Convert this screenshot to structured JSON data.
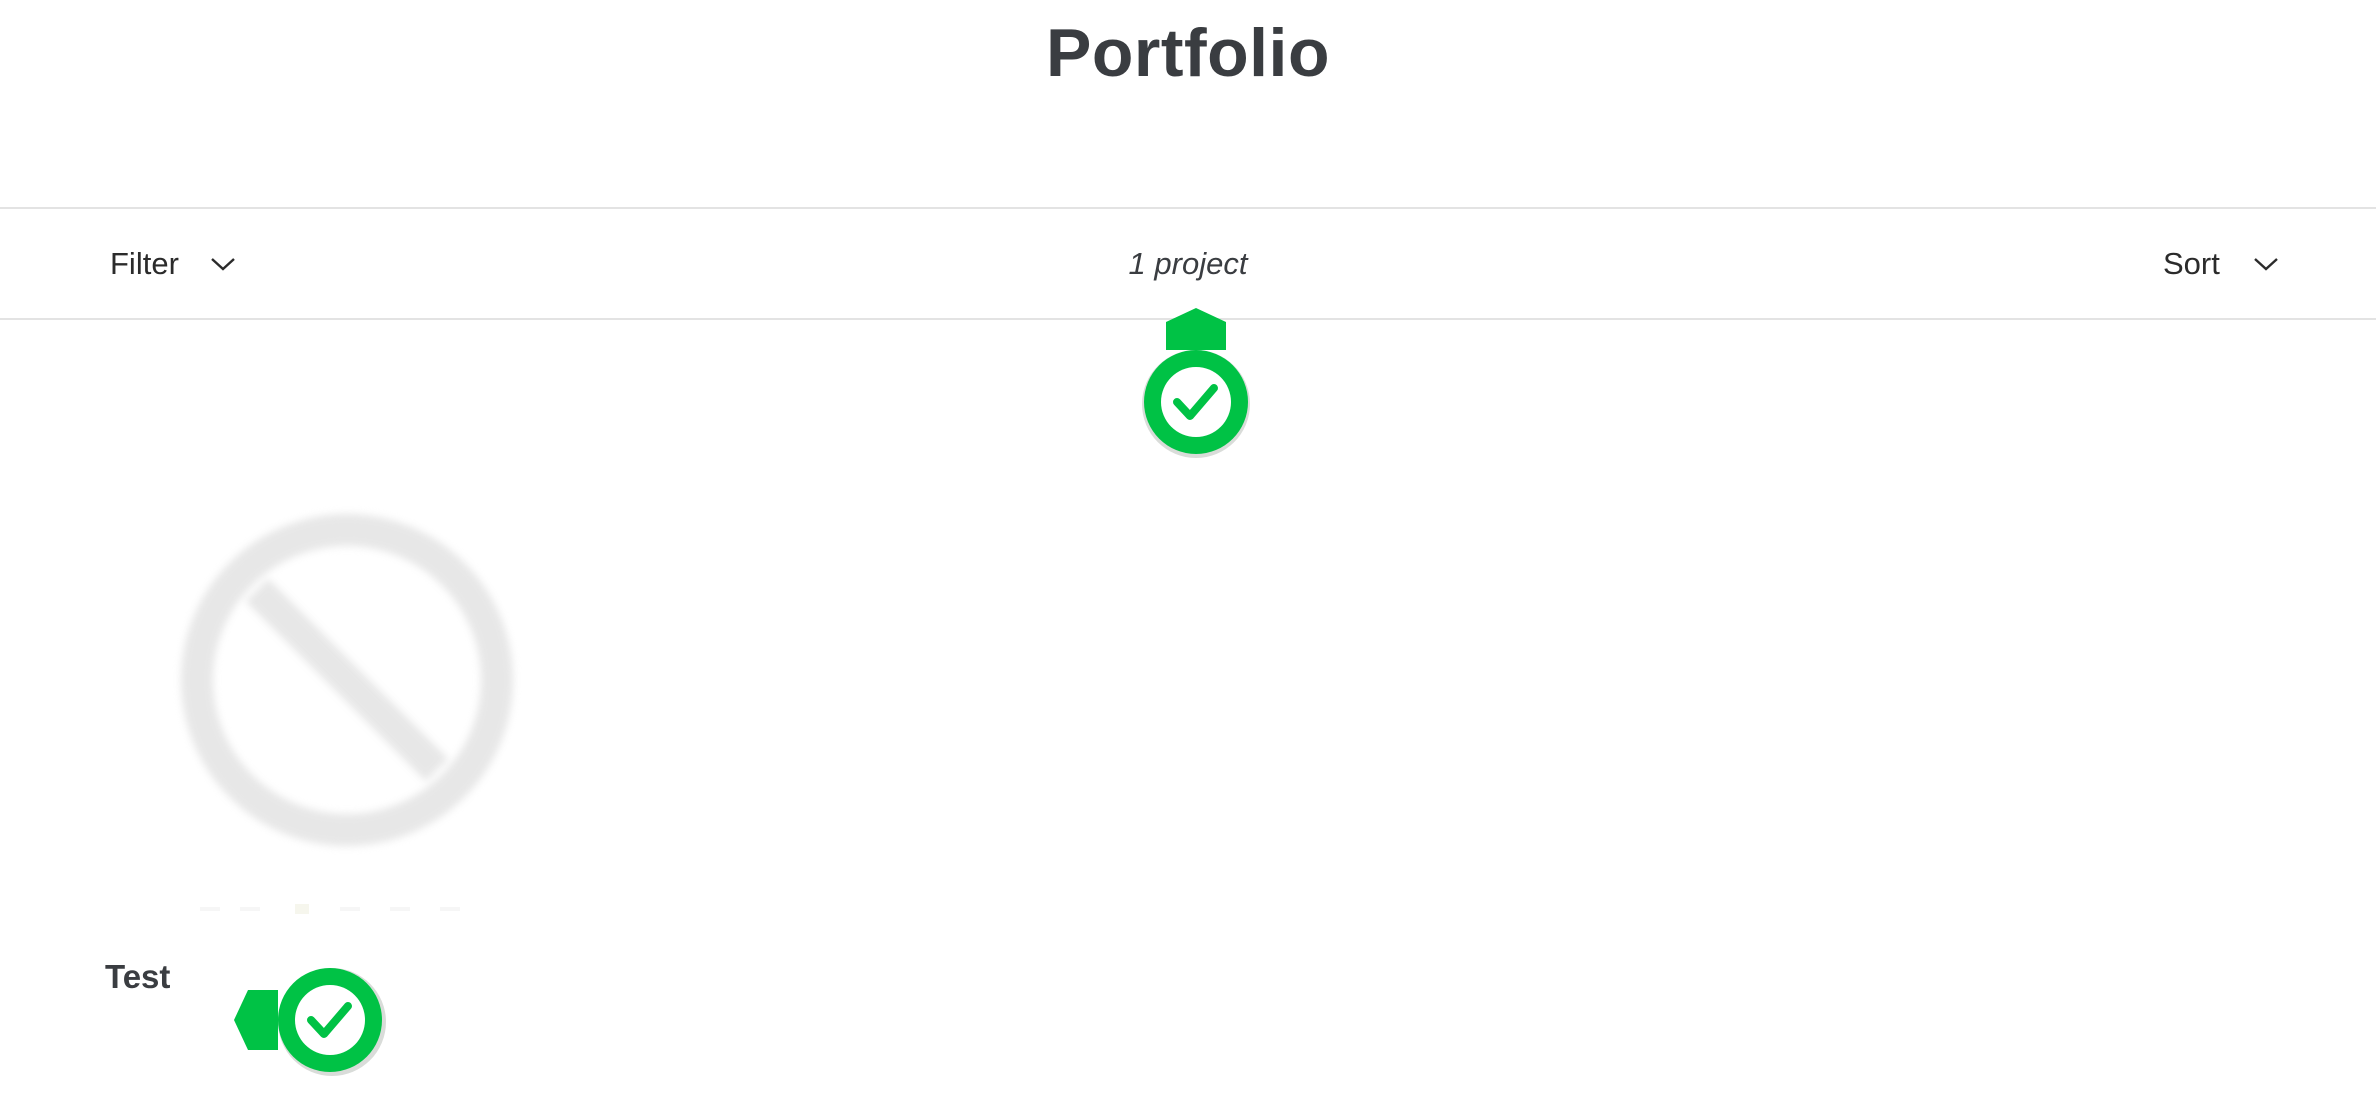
{
  "page": {
    "title": "Portfolio"
  },
  "toolbar": {
    "filter_label": "Filter",
    "project_count": "1 project",
    "sort_label": "Sort"
  },
  "projects": [
    {
      "title": "Test",
      "image_icon": "no-image-placeholder-icon"
    }
  ],
  "badges": {
    "icon": "check-circle-icon",
    "color": "#00c245"
  },
  "colors": {
    "text": "#3a3d41",
    "divider": "#e3e3e3",
    "accent_green": "#00c245"
  }
}
